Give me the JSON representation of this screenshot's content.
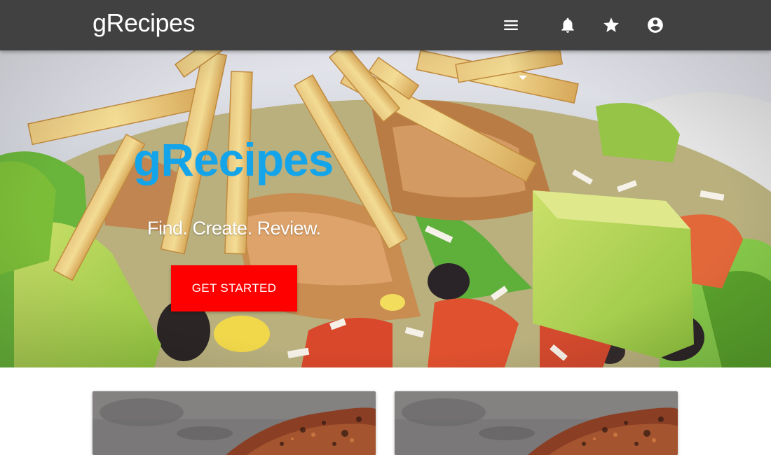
{
  "header": {
    "brand": "gRecipes",
    "icons": {
      "menu": "menu-icon",
      "notifications": "bell-icon",
      "favorites": "star-icon",
      "account": "account-circle-icon"
    }
  },
  "hero": {
    "title": "gRecipes",
    "tagline": "Find. Create. Review.",
    "cta_label": "GET STARTED"
  },
  "cards": [
    {
      "image": "grilled-meat-photo"
    },
    {
      "image": "grilled-meat-photo"
    }
  ],
  "colors": {
    "topbar": "#414141",
    "title_blue": "#14a4ea",
    "cta_red": "#ff0000",
    "text_white": "#ffffff"
  }
}
